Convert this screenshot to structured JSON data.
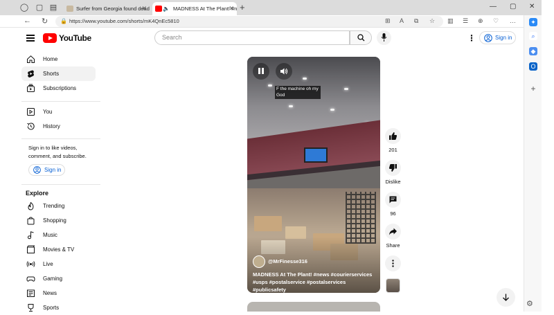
{
  "browser": {
    "tabs": [
      {
        "title": "Surfer from Georgia found dead",
        "active": false
      },
      {
        "title": "MADNESS At The Plant! #ne",
        "active": true
      }
    ],
    "url": "https://www.youtube.com/shorts/mK4QnEc5810"
  },
  "header": {
    "logo_text": "YouTube",
    "search_placeholder": "Search",
    "signin_label": "Sign in"
  },
  "guide": {
    "primary": [
      {
        "label": "Home",
        "icon": "home-icon"
      },
      {
        "label": "Shorts",
        "icon": "shorts-icon",
        "active": true
      },
      {
        "label": "Subscriptions",
        "icon": "subscriptions-icon"
      }
    ],
    "you": [
      {
        "label": "You",
        "icon": "you-icon"
      },
      {
        "label": "History",
        "icon": "history-icon"
      }
    ],
    "signin_prompt": "Sign in to like videos, comment, and subscribe.",
    "signin_label": "Sign in",
    "explore_header": "Explore",
    "explore": [
      {
        "label": "Trending",
        "icon": "trending-icon"
      },
      {
        "label": "Shopping",
        "icon": "shopping-icon"
      },
      {
        "label": "Music",
        "icon": "music-icon"
      },
      {
        "label": "Movies & TV",
        "icon": "movies-icon"
      },
      {
        "label": "Live",
        "icon": "live-icon"
      },
      {
        "label": "Gaming",
        "icon": "gaming-icon"
      },
      {
        "label": "News",
        "icon": "news-icon"
      },
      {
        "label": "Sports",
        "icon": "sports-icon"
      }
    ]
  },
  "player": {
    "caption": "F the machine oh my God",
    "channel": "@MrFinesse316",
    "title": "MADNESS At The Plant! #news #courierservices #usps #postalservice #postalservices #publicsafety"
  },
  "actions": {
    "likes": "201",
    "dislike_label": "Dislike",
    "comments": "96",
    "share_label": "Share"
  },
  "colors": {
    "brand_red": "#ff0000",
    "link_blue": "#065fd4",
    "active_bg": "#f2f2f2"
  }
}
